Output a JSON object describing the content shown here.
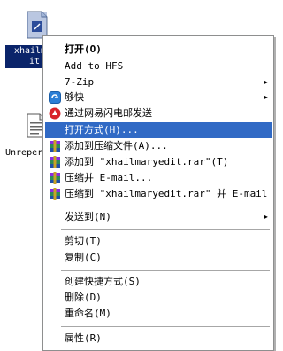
{
  "desktop": {
    "file1": {
      "label_line1": "xhailme",
      "label_line2": "it.y"
    },
    "file2": {
      "label": "Unreper"
    }
  },
  "menu": {
    "items": [
      {
        "label": "打开(O)",
        "icon": "none"
      },
      {
        "label": "Add to HFS",
        "icon": "none"
      },
      {
        "label": "7-Zip",
        "icon": "none",
        "submenu": true
      },
      {
        "label": "够快",
        "icon": "gokuai-icon",
        "submenu": true
      },
      {
        "label": "通过网易闪电邮发送",
        "icon": "netease-icon"
      },
      {
        "label": "打开方式(H)...",
        "icon": "none"
      },
      {
        "label": "添加到压缩文件(A)...",
        "icon": "winrar-icon"
      },
      {
        "label": "添加到 \"xhailmaryedit.rar\"(T)",
        "icon": "winrar-icon"
      },
      {
        "label": "压缩并 E-mail...",
        "icon": "winrar-icon"
      },
      {
        "label": "压缩到 \"xhailmaryedit.rar\" 并 E-mail",
        "icon": "winrar-icon"
      },
      {
        "label": "发送到(N)",
        "icon": "none",
        "submenu": true
      },
      {
        "label": "剪切(T)",
        "icon": "none"
      },
      {
        "label": "复制(C)",
        "icon": "none"
      },
      {
        "label": "创建快捷方式(S)",
        "icon": "none"
      },
      {
        "label": "删除(D)",
        "icon": "none"
      },
      {
        "label": "重命名(M)",
        "icon": "none"
      },
      {
        "label": "属性(R)",
        "icon": "none"
      }
    ],
    "highlight_color": "#316ac5",
    "submenu_arrow": "▶"
  }
}
